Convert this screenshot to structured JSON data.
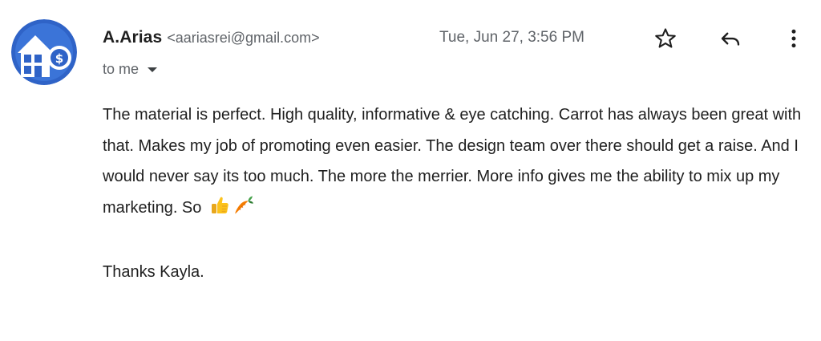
{
  "sender": {
    "name": "A.Arias",
    "email": "<aariasrei@gmail.com>"
  },
  "timestamp": "Tue, Jun 27, 3:56 PM",
  "recipient": {
    "label": "to me"
  },
  "actions": {
    "star": "star-icon",
    "reply": "reply-icon",
    "more": "more-vert-icon"
  },
  "body": {
    "paragraph": "The material is perfect. High quality, informative & eye catching. Carrot has always been great with that.  Makes my job of promoting even easier. The design team over there should get a raise. And I would never say its too much. The more the merrier. More info gives me the ability to mix up my marketing. So",
    "emojis": [
      "thumbs-up-emoji",
      "carrot-emoji"
    ],
    "signoff": "Thanks Kayla."
  },
  "colors": {
    "avatar_background": "#2f63c7",
    "sender_text": "#1f1f1f",
    "meta_text": "#5f6368"
  }
}
